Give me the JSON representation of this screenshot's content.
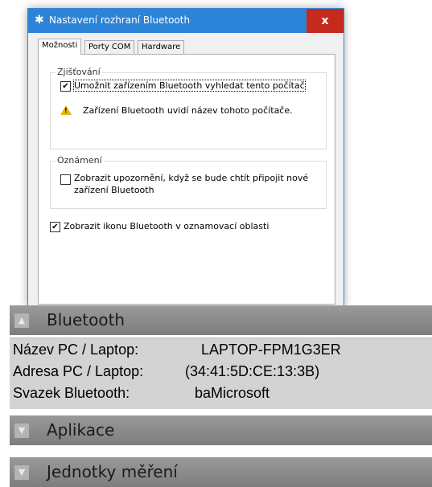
{
  "dialog": {
    "title": "Nastavení rozhraní Bluetooth",
    "bt_icon": "bluetooth-icon",
    "close_label": "x",
    "tabs": [
      {
        "label": "Možnosti",
        "active": true
      },
      {
        "label": "Porty COM",
        "active": false
      },
      {
        "label": "Hardware",
        "active": false
      }
    ],
    "discovery": {
      "title": "Zjišťování",
      "allow_label": "Umožnit zařízením Bluetooth vyhledat tento počítač",
      "allow_checked": true,
      "warning_icon": "warning-icon",
      "warning_text": "Zařízení Bluetooth uvidí název tohoto počítače."
    },
    "notifications": {
      "title": "Oznámení",
      "notify_label_line1": "Zobrazit upozornění, když se bude chtít připojit nové",
      "notify_label_line2": "zařízení Bluetooth",
      "notify_checked": false
    },
    "tray": {
      "label": "Zobrazit ikonu Bluetooth v oznamovací oblasti",
      "checked": true
    }
  },
  "panel": {
    "bluetooth": {
      "title": "Bluetooth",
      "expanded": true,
      "rows": [
        {
          "label": "Název PC / Laptop:",
          "value": "LAPTOP-FPM1G3ER"
        },
        {
          "label": "Adresa PC / Laptop:",
          "value": "(34:41:5D:CE:13:3B)"
        },
        {
          "label": "Svazek Bluetooth:",
          "value": "baMicrosoft"
        }
      ]
    },
    "apps": {
      "title": "Aplikace",
      "expanded": false
    },
    "units": {
      "title": "Jednotky měření",
      "expanded": false
    }
  },
  "colors": {
    "titlebar": "#2b84d7",
    "close": "#c42b1c",
    "section_bar": "#8c8c8c",
    "details_bg": "#d3d3d3"
  }
}
